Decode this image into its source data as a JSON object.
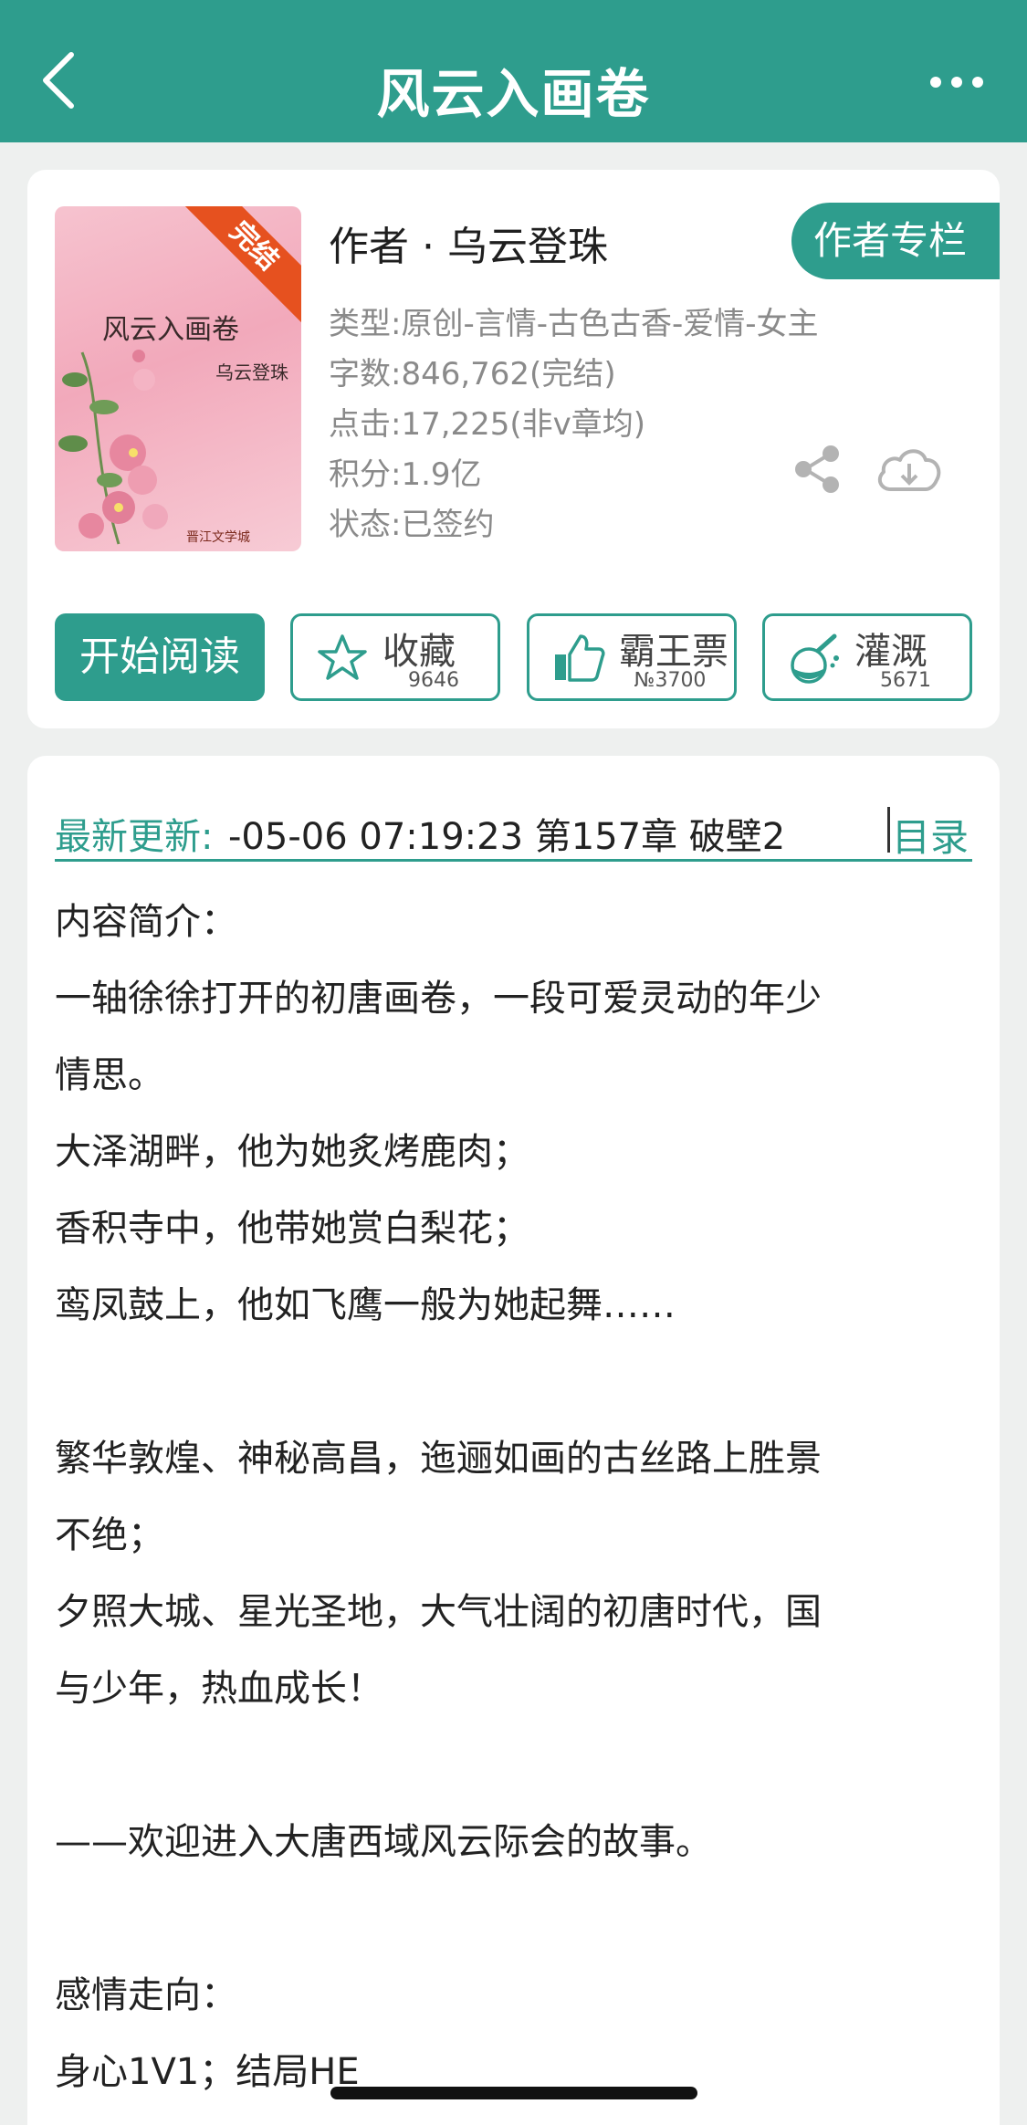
{
  "header": {
    "title": "风云入画卷"
  },
  "book": {
    "cover": {
      "badge": "完结",
      "title": "风云入画卷",
      "author": "乌云登珠",
      "logo": "晋江文学城"
    },
    "author_line": "作者 · 乌云登珠",
    "author_column_button": "作者专栏",
    "meta": {
      "type": "类型:原创-言情-古色古香-爱情-女主",
      "words": "字数:846,762(完结)",
      "clicks": "点击:17,225(非v章均)",
      "points": "积分:1.9亿",
      "status": "状态:已签约"
    }
  },
  "actions": {
    "start_reading": "开始阅读",
    "favorite": {
      "label": "收藏",
      "count": "9646"
    },
    "overlord": {
      "label": "霸王票",
      "count": "№3700"
    },
    "nutrient": {
      "label": "灌溉",
      "count": "5671"
    }
  },
  "update": {
    "label": "最新更新:",
    "text": "-05-06 07:19:23   第157章 破壁2",
    "toc": "目录"
  },
  "intro": {
    "lines": [
      "内容简介：",
      "一轴徐徐打开的初唐画卷，一段可爱灵动的年少",
      "情思。",
      "大泽湖畔，他为她炙烤鹿肉；",
      "香积寺中，他带她赏白梨花；",
      "鸾凤鼓上，他如飞鹰一般为她起舞……",
      "",
      "繁华敦煌、神秘高昌，迤逦如画的古丝路上胜景",
      "不绝；",
      "夕照大城、星光圣地，大气壮阔的初唐时代，国",
      "与少年，热血成长！",
      "",
      "——欢迎进入大唐西域风云际会的故事。",
      "",
      " 感情走向：",
      "身心1V1；结局HE"
    ]
  },
  "colors": {
    "accent": "#2e9d8d",
    "ribbon": "#e6511f"
  }
}
